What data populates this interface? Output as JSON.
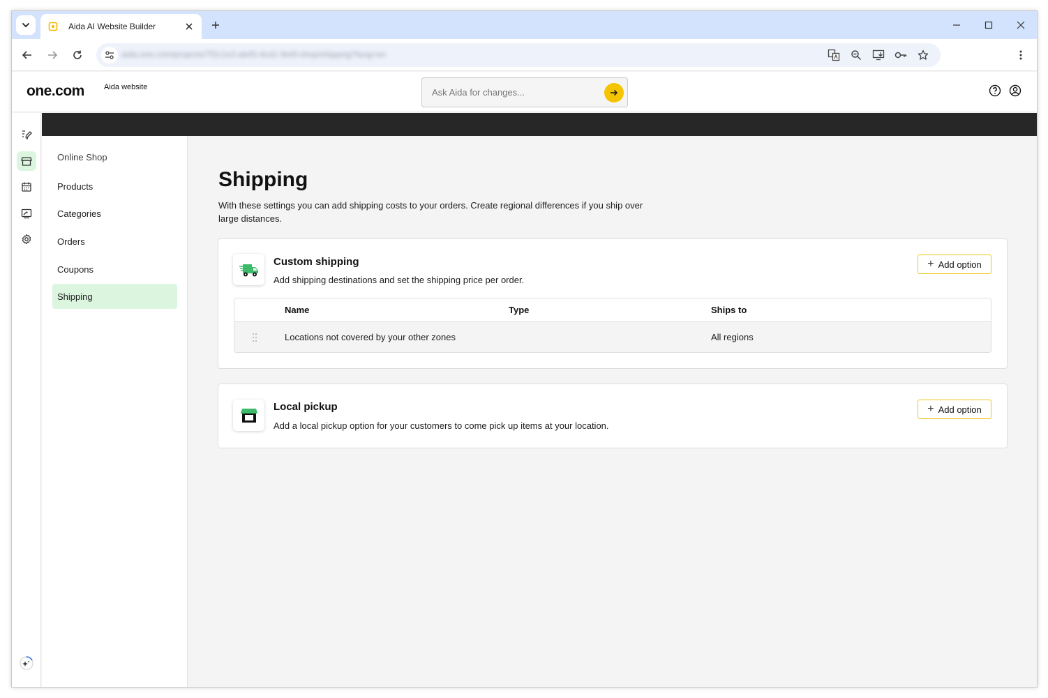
{
  "browser": {
    "tab_title": "Aida AI Website Builder",
    "url": "aida.one.com/projects/7f2c1e3-ab45-4cd1-9e0f-shop/shipping?lang=en",
    "icons": [
      "tab-search-icon",
      "translate-icon",
      "zoom-icon",
      "install-app-icon",
      "password-key-icon",
      "bookmark-star-icon"
    ]
  },
  "header": {
    "logo": "one.com",
    "site_name": "Aida website",
    "ask_placeholder": "Ask Aida for changes..."
  },
  "rail": {
    "items": [
      "edit-icon",
      "shop-icon",
      "calendar-icon",
      "blog-icon",
      "settings-icon"
    ],
    "active": "shop-icon"
  },
  "sidenav": {
    "title": "Online Shop",
    "items": [
      {
        "label": "Products"
      },
      {
        "label": "Categories"
      },
      {
        "label": "Orders"
      },
      {
        "label": "Coupons"
      },
      {
        "label": "Shipping"
      }
    ],
    "active": "Shipping"
  },
  "page": {
    "title": "Shipping",
    "description": "With these settings you can add shipping costs to your orders. Create regional differences if you ship over large distances."
  },
  "custom_shipping": {
    "title": "Custom shipping",
    "description": "Add shipping destinations and set the shipping price per order.",
    "button": "Add option",
    "columns": [
      "Name",
      "Type",
      "Ships to"
    ],
    "rows": [
      {
        "name": "Locations not covered by your other zones",
        "type": "",
        "ships_to": "All regions"
      }
    ]
  },
  "local_pickup": {
    "title": "Local pickup",
    "description": "Add a local pickup option for your customers to come pick up items at your location.",
    "button": "Add option"
  },
  "colors": {
    "accent_yellow": "#f5c400",
    "active_green": "#dcf5df",
    "icon_green": "#3dbb6a"
  }
}
